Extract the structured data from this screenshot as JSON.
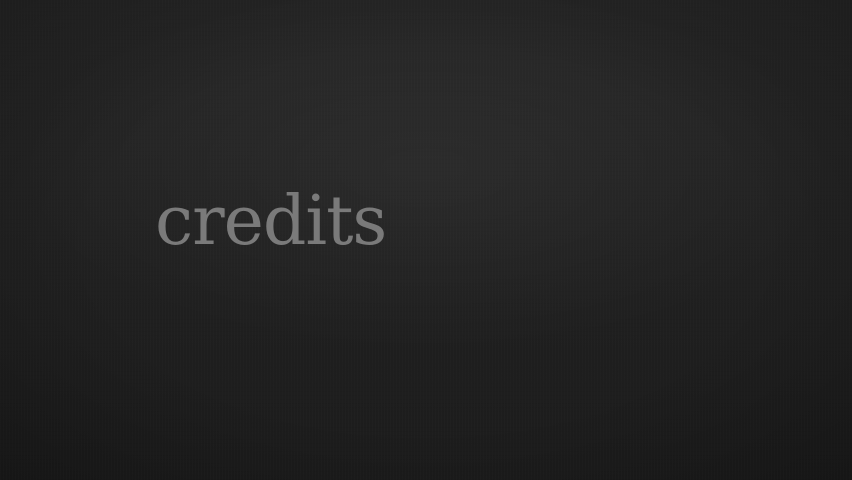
{
  "screen": {
    "title": "credits"
  },
  "colors": {
    "background": "#222222",
    "title_text": "#7a7a7a"
  }
}
